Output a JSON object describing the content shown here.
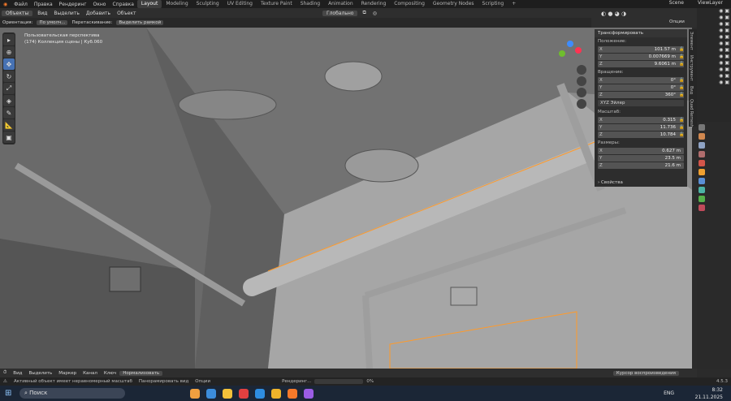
{
  "topbar": {
    "menus": [
      "Файл",
      "Правка",
      "Рендеринг",
      "Окно",
      "Справка"
    ],
    "workspaces": [
      "Layout",
      "Modeling",
      "Sculpting",
      "UV Editing",
      "Texture Paint",
      "Shading",
      "Animation",
      "Rendering",
      "Compositing",
      "Geometry Nodes",
      "Scripting"
    ],
    "active_workspace": "Layout",
    "scene": "Scene",
    "view_layer": "ViewLayer"
  },
  "header": {
    "mode": "Объекты",
    "menus": [
      "Вид",
      "Выделить",
      "Добавить",
      "Объект"
    ],
    "transform_space": "Глобально",
    "options": "Опции"
  },
  "header2": {
    "orientation_label": "Ориентация:",
    "orientation_value": "По умолч...",
    "drag_label": "Перетаскивание:",
    "drag_value": "Выделить рамкой"
  },
  "viewport": {
    "view_name": "Пользовательская перспектива",
    "collection_info": "(174) Коллекция сцены | Куб.060"
  },
  "npanel": {
    "title": "Трансформировать",
    "location_label": "Положение:",
    "location": [
      {
        "k": "X",
        "v": "101.57 m"
      },
      {
        "k": "Y",
        "v": "0.007669 m"
      },
      {
        "k": "Z",
        "v": "9.6061 m"
      }
    ],
    "rotation_label": "Вращение:",
    "rotation": [
      {
        "k": "X",
        "v": "0°"
      },
      {
        "k": "Y",
        "v": "0°"
      },
      {
        "k": "Z",
        "v": "360°"
      }
    ],
    "rotation_mode": "XYZ Эйлер",
    "scale_label": "Масштаб:",
    "scale": [
      {
        "k": "X",
        "v": "0.315"
      },
      {
        "k": "Y",
        "v": "11.736"
      },
      {
        "k": "Z",
        "v": "10.784"
      }
    ],
    "dims_label": "Размеры:",
    "dims": [
      {
        "k": "X",
        "v": "0.627 m"
      },
      {
        "k": "Y",
        "v": "23.5 m"
      },
      {
        "k": "Z",
        "v": "21.6 m"
      }
    ],
    "properties": "Свойства"
  },
  "side_tabs": [
    "Элемент",
    "Инструмент",
    "Вид",
    "Quad Remesh"
  ],
  "timeline": {
    "menus": [
      "Вид",
      "Выделить",
      "Маркер",
      "Канал",
      "Ключ"
    ],
    "normalize": "Нормализовать",
    "keying": "Курсор воспроизведения"
  },
  "status": {
    "warning": "Активный объект имеет неравномерный масштаб",
    "pan": "Панорамировать вид",
    "options": "Опции",
    "render": "Рендеринг...",
    "progress_text": "0%",
    "progress": 0,
    "version": "4.5.3"
  },
  "taskbar": {
    "search": "Поиск",
    "lang": "ENG",
    "time": "8:32",
    "date": "21.11.2025"
  }
}
